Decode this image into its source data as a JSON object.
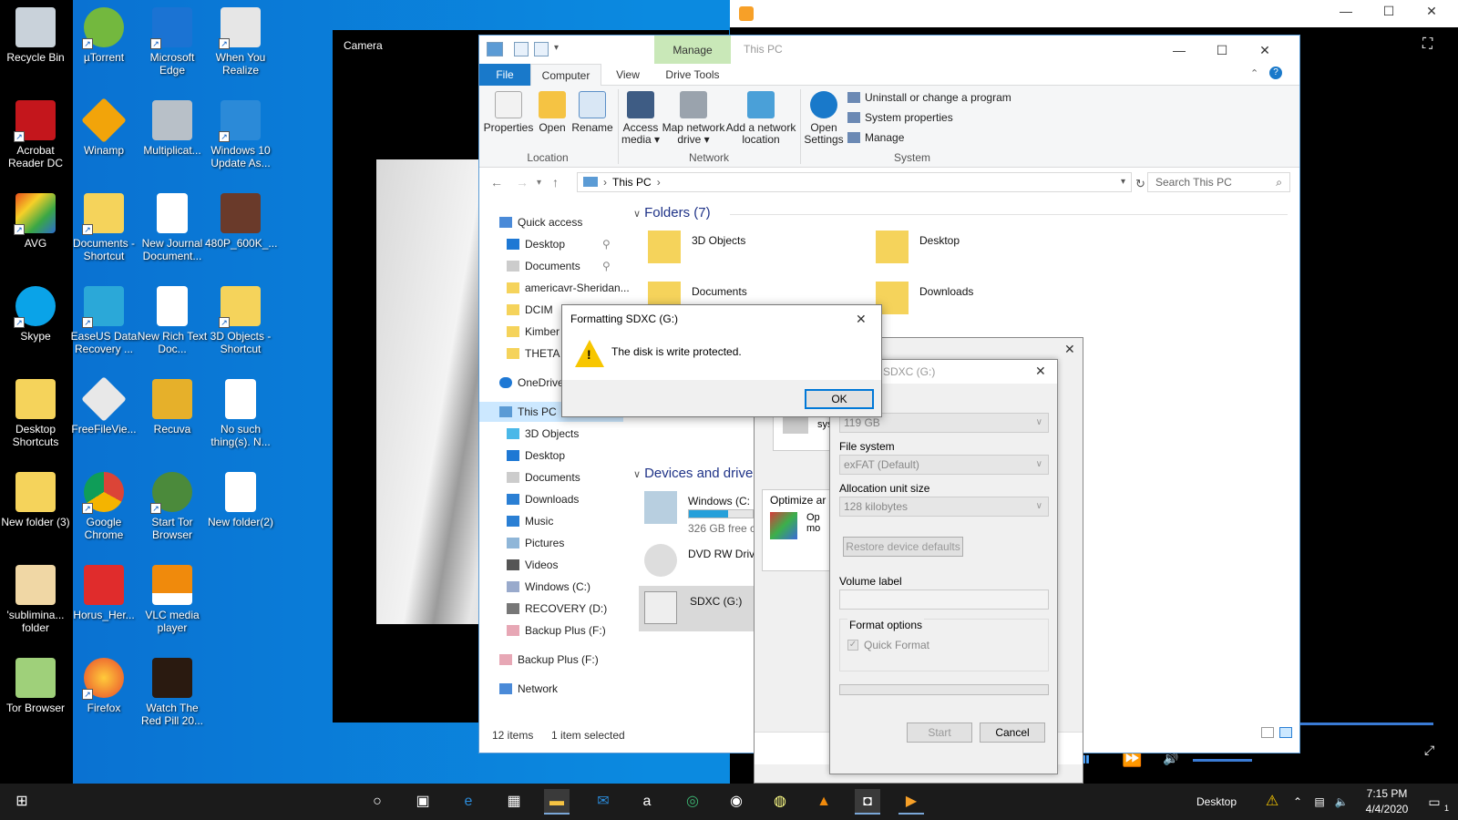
{
  "desktop": {
    "icons": [
      {
        "label": "Recycle Bin"
      },
      {
        "label": "µTorrent"
      },
      {
        "label": "Microsoft Edge"
      },
      {
        "label": "When You Realize"
      },
      {
        "label": "Acrobat Reader DC"
      },
      {
        "label": "Winamp"
      },
      {
        "label": "Multiplicat..."
      },
      {
        "label": "Windows 10 Update As..."
      },
      {
        "label": "AVG"
      },
      {
        "label": "Documents - Shortcut"
      },
      {
        "label": "New Journal Document..."
      },
      {
        "label": "480P_600K_..."
      },
      {
        "label": "Skype"
      },
      {
        "label": "EaseUS Data Recovery ..."
      },
      {
        "label": "New Rich Text Doc..."
      },
      {
        "label": "3D Objects - Shortcut"
      },
      {
        "label": "Desktop Shortcuts"
      },
      {
        "label": "FreeFileVie..."
      },
      {
        "label": "Recuva"
      },
      {
        "label": "No such thing(s). N..."
      },
      {
        "label": "New folder (3)"
      },
      {
        "label": "Google Chrome"
      },
      {
        "label": "Start Tor Browser"
      },
      {
        "label": "New folder(2)"
      },
      {
        "label": "'sublimina... folder"
      },
      {
        "label": "Horus_Her..."
      },
      {
        "label": "VLC media player"
      },
      {
        "label": "Tor Browser"
      },
      {
        "label": "Firefox"
      },
      {
        "label": "Watch The Red Pill 20..."
      }
    ]
  },
  "camera": {
    "title": "Camera"
  },
  "explorer": {
    "title": "This PC",
    "manage_tab": "Manage",
    "tabs": [
      "File",
      "Computer",
      "View",
      "Drive Tools"
    ],
    "ribbon": {
      "properties": "Properties",
      "open": "Open",
      "rename": "Rename",
      "access_media": "Access media ▾",
      "map_drive": "Map network drive ▾",
      "add_location": "Add a network location",
      "open_settings": "Open Settings",
      "uninstall": "Uninstall or change a program",
      "system_props": "System properties",
      "manage": "Manage",
      "group_location": "Location",
      "group_network": "Network",
      "group_system": "System"
    },
    "address": "This PC",
    "search_placeholder": "Search This PC",
    "nav": [
      "Quick access",
      "Desktop",
      "Documents",
      "americavr-Sheridan...",
      "DCIM",
      "Kimber",
      "THETA",
      "OneDrive",
      "This PC",
      "3D Objects",
      "Desktop",
      "Documents",
      "Downloads",
      "Music",
      "Pictures",
      "Videos",
      "Windows (C:)",
      "RECOVERY (D:)",
      "Backup Plus (F:)",
      "Backup Plus (F:)",
      "Network"
    ],
    "folders_header": "Folders (7)",
    "folders": [
      "3D Objects",
      "Desktop",
      "Documents",
      "Downloads"
    ],
    "devices_header": "Devices and drive",
    "devices": [
      {
        "name": "Windows (C:",
        "detail": "326 GB free c",
        "fill": 0.62
      },
      {
        "name": "DVD RW Driv",
        "detail": "",
        "fill": 0
      },
      {
        "name": "SDXC (G:)",
        "detail": "",
        "fill": 0
      }
    ],
    "status_items": "12 items",
    "status_selected": "1 item selected"
  },
  "format_back": {
    "opt_text1": "Thi",
    "opt_text2": "sys",
    "optimize": "Optimize ar",
    "opt3": "Op",
    "opt4": "mo"
  },
  "format": {
    "title": "g SDXC (G:)",
    "capacity": "119 GB",
    "fs_label": "File system",
    "fs_value": "exFAT (Default)",
    "alloc_label": "Allocation unit size",
    "alloc_value": "128 kilobytes",
    "restore": "Restore device defaults",
    "volume_label": "Volume label",
    "format_options": "Format options",
    "quick_format": "Quick Format",
    "start": "Start",
    "cancel": "Cancel"
  },
  "error_dialog": {
    "title": "Formatting SDXC (G:)",
    "message": "The disk is write protected.",
    "ok": "OK"
  },
  "taskbar": {
    "desktop_label": "Desktop",
    "time": "7:15 PM",
    "date": "4/4/2020",
    "notif_count": "1"
  }
}
